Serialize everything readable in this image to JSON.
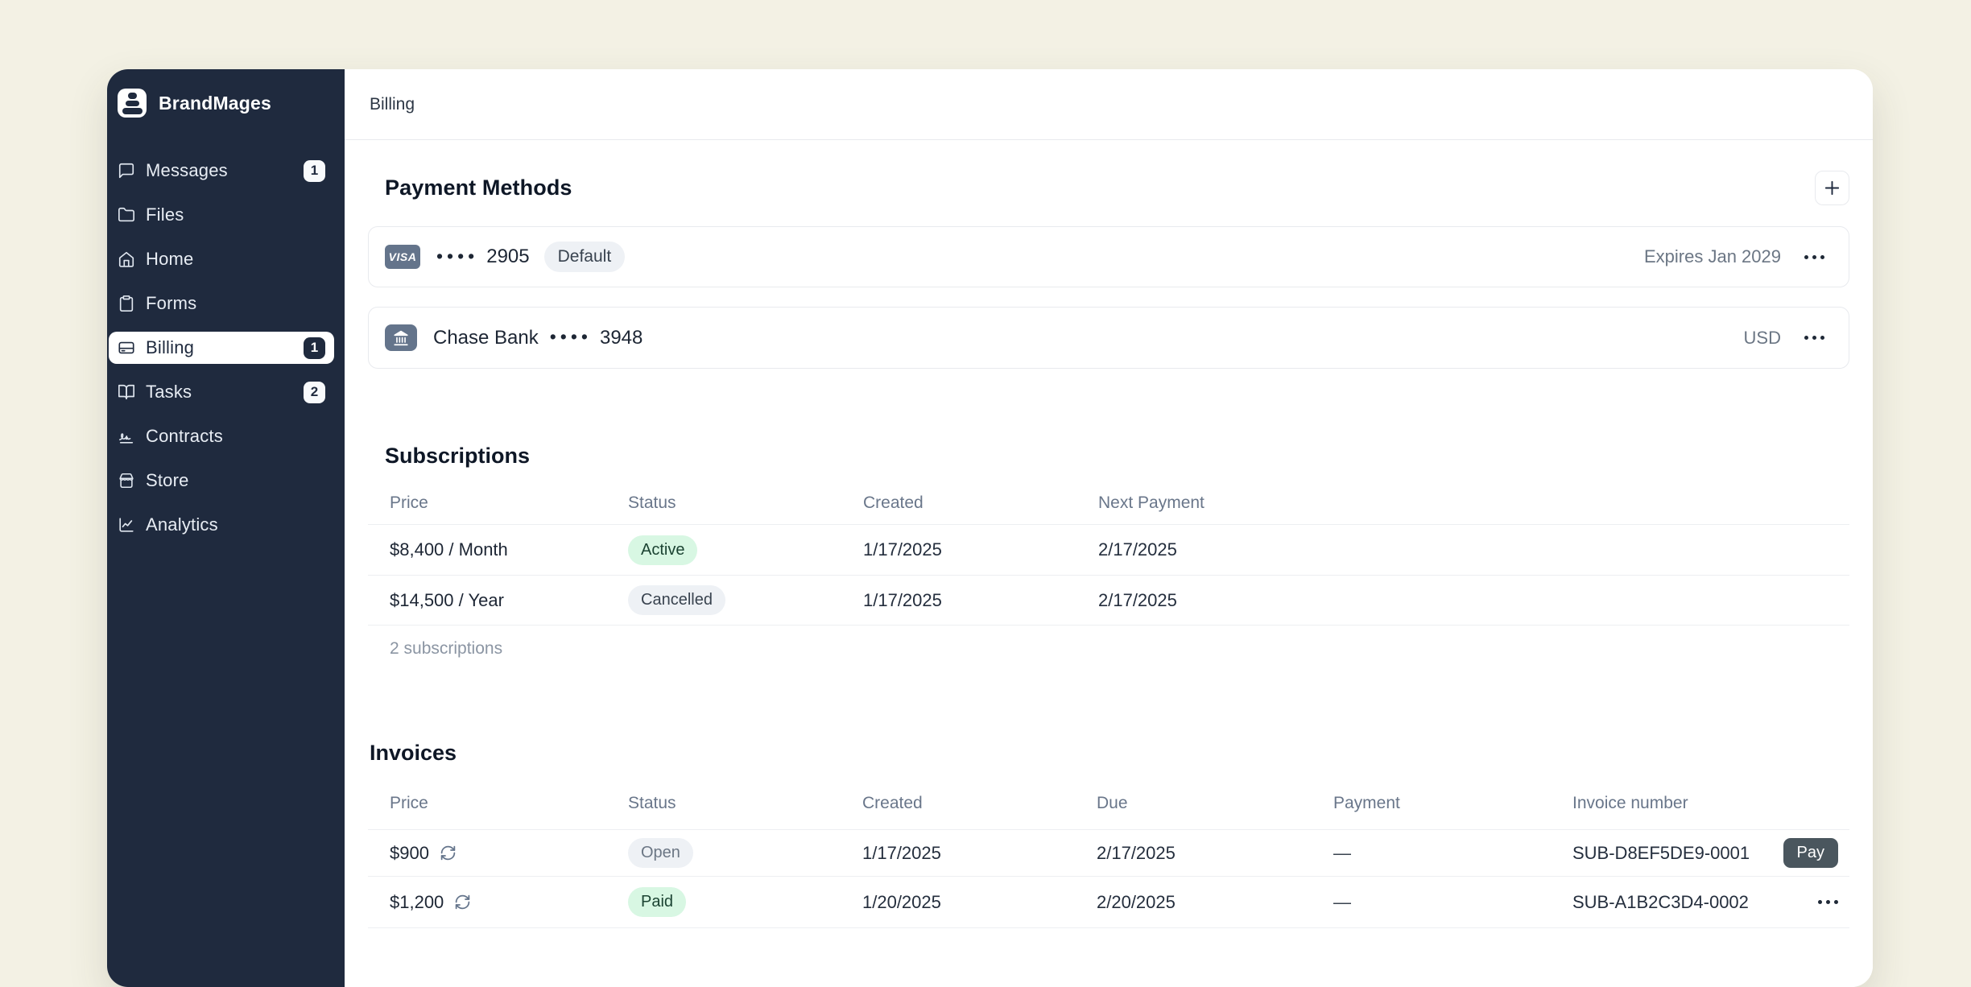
{
  "app": {
    "brand": "BrandMages"
  },
  "topbar": {
    "title": "Billing"
  },
  "sidebar": {
    "items": [
      {
        "label": "Messages",
        "badge": "1"
      },
      {
        "label": "Files",
        "badge": ""
      },
      {
        "label": "Home",
        "badge": ""
      },
      {
        "label": "Forms",
        "badge": ""
      },
      {
        "label": "Billing",
        "badge": "1"
      },
      {
        "label": "Tasks",
        "badge": "2"
      },
      {
        "label": "Contracts",
        "badge": ""
      },
      {
        "label": "Store",
        "badge": ""
      },
      {
        "label": "Analytics",
        "badge": ""
      }
    ]
  },
  "payment_methods": {
    "title": "Payment Methods",
    "cards": [
      {
        "brand": "VISA",
        "masked": "••••",
        "last4": "2905",
        "default_badge": "Default",
        "meta": "Expires Jan 2029"
      },
      {
        "bank_name": "Chase Bank",
        "masked": "••••",
        "last4": "3948",
        "meta": "USD"
      }
    ]
  },
  "subscriptions": {
    "title": "Subscriptions",
    "columns": [
      "Price",
      "Status",
      "Created",
      "Next Payment"
    ],
    "rows": [
      {
        "price": "$8,400 / Month",
        "status": "Active",
        "created": "1/17/2025",
        "next_payment": "2/17/2025"
      },
      {
        "price": "$14,500 / Year",
        "status": "Cancelled",
        "created": "1/17/2025",
        "next_payment": "2/17/2025"
      }
    ],
    "footer": "2 subscriptions"
  },
  "invoices": {
    "title": "Invoices",
    "columns": [
      "Price",
      "Status",
      "Created",
      "Due",
      "Payment",
      "Invoice number"
    ],
    "rows": [
      {
        "price": "$900",
        "status": "Open",
        "created": "1/17/2025",
        "due": "2/17/2025",
        "payment": "—",
        "number": "SUB-D8EF5DE9-0001",
        "action": "Pay"
      },
      {
        "price": "$1,200",
        "status": "Paid",
        "created": "1/20/2025",
        "due": "2/20/2025",
        "payment": "—",
        "number": "SUB-A1B2C3D4-0002",
        "action": ""
      }
    ]
  },
  "colors": {
    "canvas": "#f3f1e4",
    "sidebar": "#1f2a3e",
    "surface": "#ffffff",
    "border": "#e8eaee",
    "text_primary": "#1d2634",
    "text_secondary": "#6b7684",
    "badge_green_bg": "#d8f7e3",
    "badge_green_text": "#1b4332",
    "badge_gray_bg": "#eef1f5",
    "pay_button": "#4a565e",
    "card_brand_bg": "#64748b"
  }
}
